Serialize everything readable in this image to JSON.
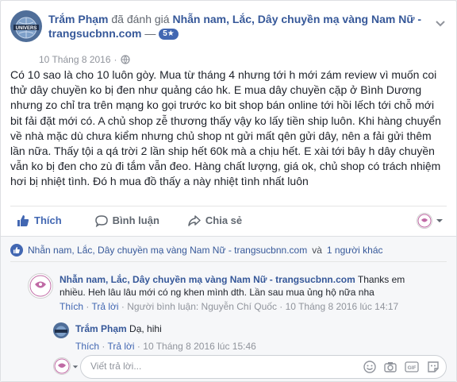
{
  "post": {
    "author": "Trắm Phạm",
    "verb": "đã đánh giá",
    "page": "Nhẫn nam, Lắc, Dây chuyền mạ vàng Nam Nữ - trangsucbnn.com",
    "rating_sep": "—",
    "rating": "5★",
    "date": "10 Tháng 8 2016",
    "meta_sep": "·",
    "body": "Có 10 sao là cho 10 luôn gòy. Mua từ tháng 4 nhưng tới h mới zám review vì muốn coi thử dây chuyền ko bị đen như quảng cáo hk. E mua dây chuyền cặp ở Bình Dương nhưng zo chỉ tra trên mạng ko gọi trước ko bit shop bán online tới hồi lếch tới chỗ mới bit fải đặt mới có. A chủ shop zễ thương thấy vậy ko lấy tiền ship luôn. Khi hàng chuyển về nhà mặc dù chưa kiểm nhưng chủ shop nt gửi mất qên gửi dây, nên a fải gửi thêm lần nữa. Thấy tội a qá trời 2 lần ship hết 60k mà a chịu hết. E xài tới bây h dây chuyền vẫn ko bị đen cho zù đi tắm vẫn đeo. Hàng chất lượng, giá ok, chủ shop có trách nhiệm hơi bị nhiệt tình. Đó h mua đồ thấy a này nhiệt tình nhất luôn"
  },
  "actions": {
    "like": "Thích",
    "comment": "Bình luận",
    "share": "Chia sẻ"
  },
  "likes": {
    "page": "Nhẫn nam, Lắc, Dây chuyền mạ vàng Nam Nữ - trangsucbnn.com",
    "connector": "và",
    "others": "1 người khác"
  },
  "comments": [
    {
      "author": "Nhẫn nam, Lắc, Dây chuyền mạ vàng Nam Nữ - trangsucbnn.com",
      "text_1": "Thanks em",
      "text_2": "nhiều. Heh lâu lâu mới có ng khen mình dth. Lần sau mua ủng hộ nữa nha",
      "like": "Thích",
      "reply": "Trả lời",
      "sep": "·",
      "commenter": "Người bình luận: Nguyễn Chí Quốc",
      "time": "10 Tháng 8 2016 lúc 14:17"
    },
    {
      "author": "Trắm Phạm",
      "text": "Dạ, hihi",
      "like": "Thích",
      "reply": "Trả lời",
      "sep": "·",
      "time": "10 Tháng 8 2016 lúc 15:46"
    }
  ],
  "reply_box": {
    "placeholder": "Viết trả lời..."
  },
  "colors": {
    "link": "#365899",
    "accent": "#4267b2",
    "muted": "#90949c"
  }
}
